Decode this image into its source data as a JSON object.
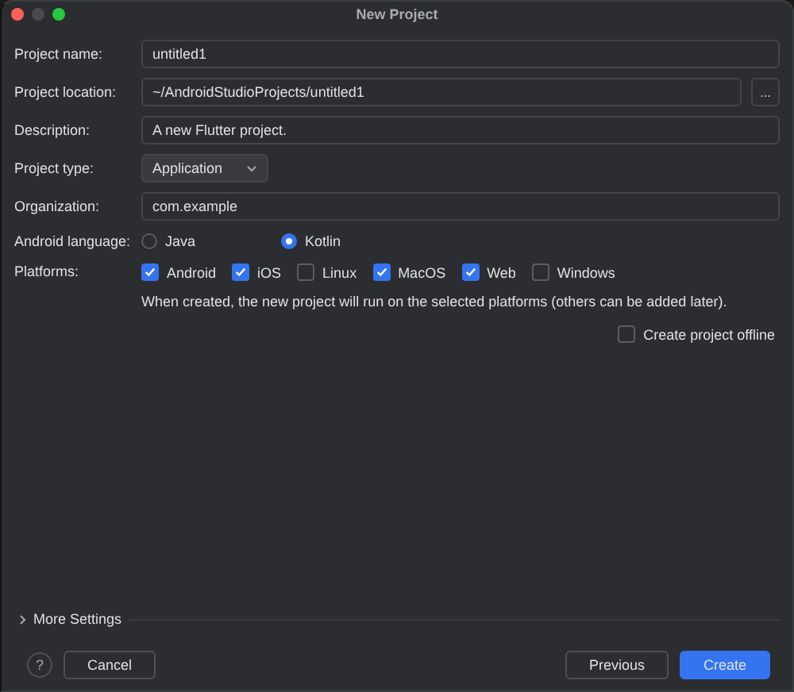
{
  "window": {
    "title": "New Project"
  },
  "fields": [
    {
      "label": "Project name:",
      "kind": "text",
      "value": "untitled1"
    },
    {
      "label": "Project location:",
      "kind": "browse",
      "value": "~/AndroidStudioProjects/untitled1",
      "button": "..."
    },
    {
      "label": "Description:",
      "kind": "text",
      "value": "A new Flutter project."
    },
    {
      "label": "Project type:",
      "kind": "select",
      "value": "Application"
    },
    {
      "label": "Organization:",
      "kind": "text",
      "value": "com.example"
    }
  ],
  "android_language": {
    "label": "Android language:",
    "options": [
      {
        "label": "Java",
        "selected": false
      },
      {
        "label": "Kotlin",
        "selected": true
      }
    ]
  },
  "platforms": {
    "label": "Platforms:",
    "options": [
      {
        "label": "Android",
        "checked": true
      },
      {
        "label": "iOS",
        "checked": true
      },
      {
        "label": "Linux",
        "checked": false
      },
      {
        "label": "MacOS",
        "checked": true
      },
      {
        "label": "Web",
        "checked": true
      },
      {
        "label": "Windows",
        "checked": false
      }
    ],
    "note": "When created, the new project will run on the selected platforms (others can be added later)."
  },
  "offline": {
    "label": "Create project offline",
    "checked": false
  },
  "more_settings": {
    "label": "More Settings",
    "expanded": false
  },
  "buttons": {
    "help": "?",
    "cancel": "Cancel",
    "previous": "Previous",
    "create": "Create"
  }
}
